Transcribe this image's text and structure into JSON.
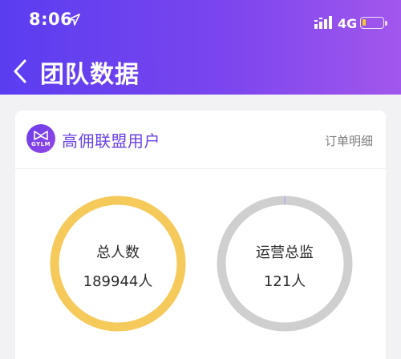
{
  "status_bar": {
    "time": "8:06",
    "network": "4G",
    "location_icon": "location-arrow-icon",
    "signal_icon": "signal-bars-icon",
    "battery_icon": "battery-low-icon",
    "battery_fill_color": "#f4cc2a"
  },
  "header": {
    "title": "团队数据",
    "back_icon": "chevron-left-icon",
    "gradient_colors": [
      "#5a3df0",
      "#a257ec"
    ]
  },
  "card": {
    "logo_text": "GYLM",
    "brand_name": "高佣联盟用户",
    "order_link": "订单明细",
    "brand_color": "#6a42e8"
  },
  "stats": {
    "total": {
      "label": "总人数",
      "value": "189944人",
      "ring_color": "#f5c95a"
    },
    "ops": {
      "label": "运营总监",
      "value": "121人",
      "ring_color": "#cfcfcf",
      "accent_color": "#b9aee6"
    }
  }
}
